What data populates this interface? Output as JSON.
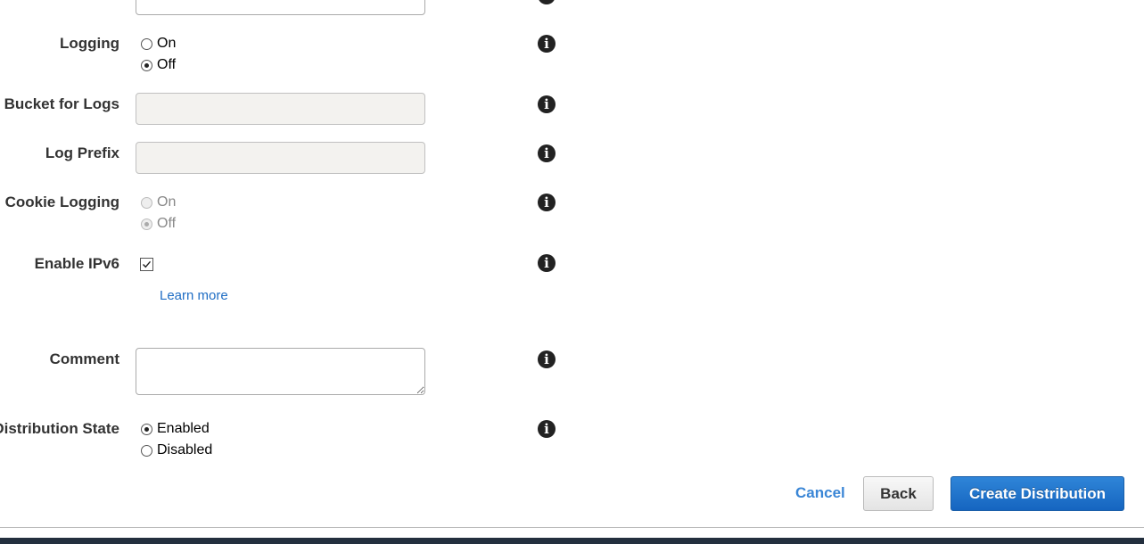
{
  "form": {
    "logging": {
      "label": "Logging",
      "options": [
        {
          "label": "On",
          "checked": false
        },
        {
          "label": "Off",
          "checked": true
        }
      ]
    },
    "bucket_for_logs": {
      "label": "Bucket for Logs",
      "value": "",
      "disabled": true
    },
    "log_prefix": {
      "label": "Log Prefix",
      "value": "",
      "disabled": true
    },
    "cookie_logging": {
      "label": "Cookie Logging",
      "disabled": true,
      "options": [
        {
          "label": "On",
          "checked": false
        },
        {
          "label": "Off",
          "checked": true
        }
      ]
    },
    "enable_ipv6": {
      "label": "Enable IPv6",
      "checked": true,
      "learn_more": "Learn more"
    },
    "comment": {
      "label": "Comment",
      "value": ""
    },
    "distribution_state": {
      "label": "Distribution State",
      "options": [
        {
          "label": "Enabled",
          "checked": true
        },
        {
          "label": "Disabled",
          "checked": false
        }
      ]
    },
    "info_icon": "i"
  },
  "actions": {
    "cancel": "Cancel",
    "back": "Back",
    "create": "Create Distribution"
  },
  "colors": {
    "primary": "#1565c0",
    "link": "#1f6dc4",
    "footer": "#232f3e"
  }
}
